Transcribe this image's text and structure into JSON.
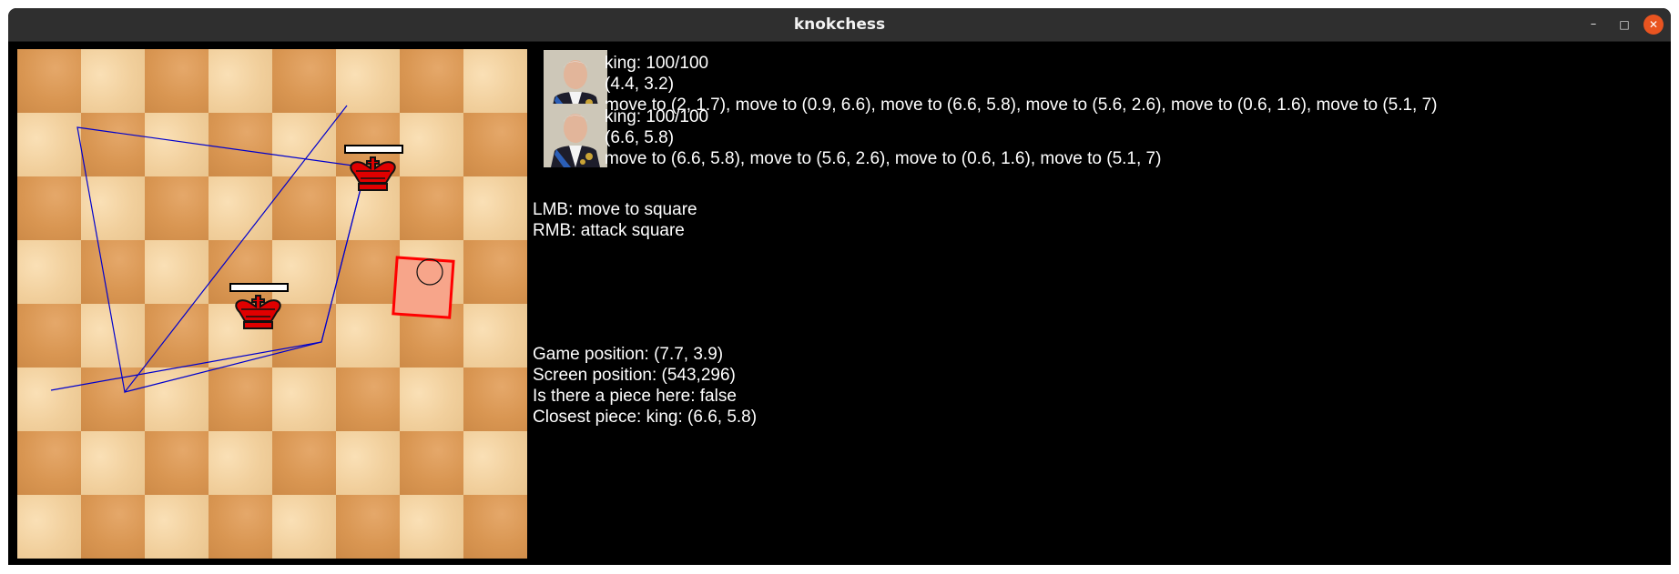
{
  "window": {
    "title": "knokchess",
    "minimize_icon": "minimize-icon",
    "maximize_icon": "maximize-icon",
    "close_icon": "close-icon",
    "minimize_glyph": "–",
    "maximize_glyph": "□",
    "close_glyph": "✕",
    "close_color": "#e95420"
  },
  "board": {
    "rows": 8,
    "cols": 8,
    "light_color": "#f1cf9c",
    "dark_color": "#d99652"
  },
  "pieces": [
    {
      "type": "king",
      "color": "#e00000",
      "icon": "king-icon",
      "health": "100/100",
      "position_text": "(4.4, 3.2)",
      "moves_text": "move to (2, 1.7), move to (0.9, 6.6), move to (6.6, 5.8), move to (5.6, 2.6), move to (0.6, 1.6), move to (5.1, 7)"
    },
    {
      "type": "king",
      "color": "#e00000",
      "icon": "king-icon",
      "health": "100/100",
      "position_text": "(6.6, 5.8)",
      "moves_text": "move to (6.6, 5.8), move to (5.6, 2.6), move to (0.6, 1.6), move to (5.1, 7)"
    }
  ],
  "piece_labels": [
    "king: 100/100",
    "king: 100/100"
  ],
  "help": {
    "lmb": "LMB: move to square",
    "rmb": "RMB: attack square"
  },
  "cursor_info": {
    "game_position": "Game position: (7.7, 3.9)",
    "screen_position": "Screen position: (543,296)",
    "piece_here": "Is there a piece here: false",
    "closest_piece": "Closest piece: king: (6.6, 5.8)"
  },
  "highlight": {
    "border_color": "#ff0000",
    "fill_color": "#f7a58a"
  },
  "path_color": "#0000cc"
}
